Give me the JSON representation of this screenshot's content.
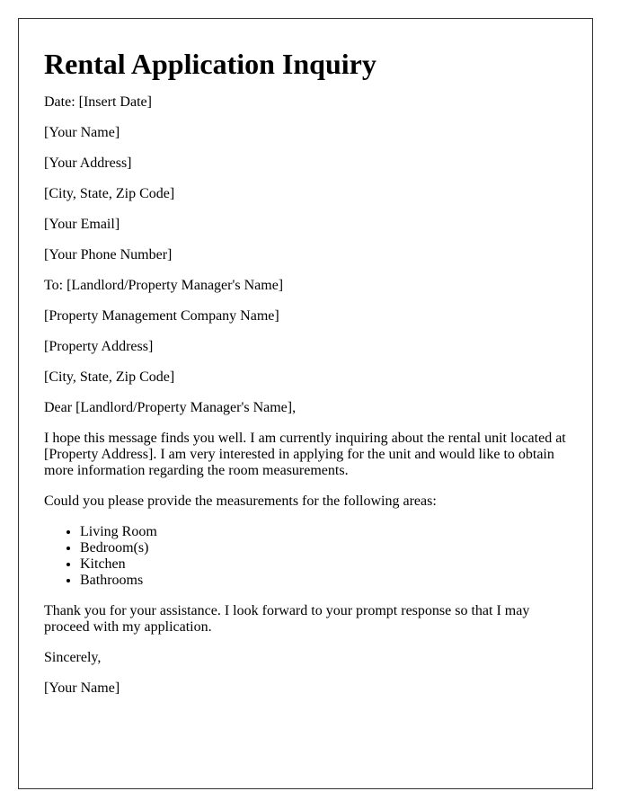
{
  "title": "Rental Application Inquiry",
  "date_line": "Date: [Insert Date]",
  "sender": {
    "name": "[Your Name]",
    "address": "[Your Address]",
    "city_state_zip": "[City, State, Zip Code]",
    "email": "[Your Email]",
    "phone": "[Your Phone Number]"
  },
  "recipient": {
    "to_line": "To: [Landlord/Property Manager's Name]",
    "company": "[Property Management Company Name]",
    "address": "[Property Address]",
    "city_state_zip": "[City, State, Zip Code]"
  },
  "salutation": "Dear [Landlord/Property Manager's Name],",
  "body": {
    "intro": "I hope this message finds you well. I am currently inquiring about the rental unit located at [Property Address]. I am very interested in applying for the unit and would like to obtain more information regarding the room measurements.",
    "request": "Could you please provide the measurements for the following areas:",
    "areas": [
      "Living Room",
      "Bedroom(s)",
      "Kitchen",
      "Bathrooms"
    ],
    "closing_paragraph": "Thank you for your assistance. I look forward to your prompt response so that I may proceed with my application."
  },
  "closing": "Sincerely,",
  "signature": "[Your Name]"
}
